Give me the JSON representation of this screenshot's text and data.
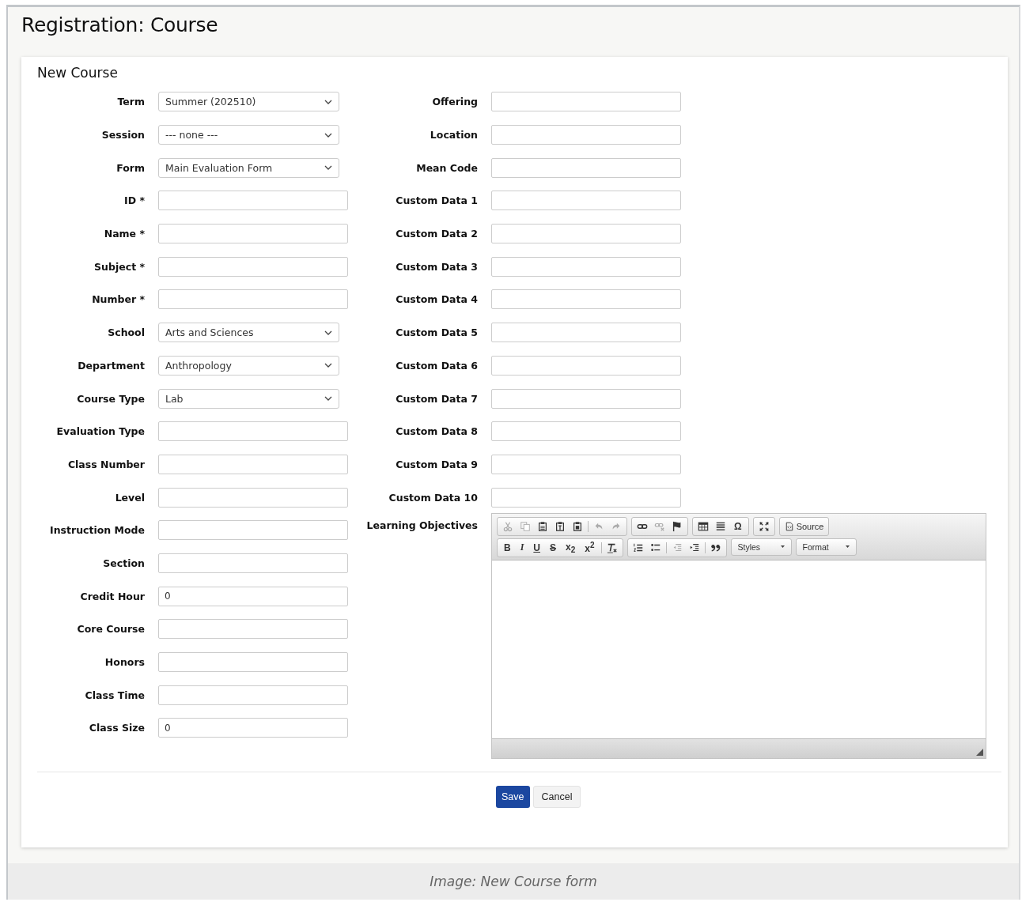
{
  "page": {
    "title": "Registration: Course"
  },
  "form": {
    "title": "New Course",
    "left_fields": [
      {
        "label": "Term",
        "kind": "select",
        "value": "Summer (202510)"
      },
      {
        "label": "Session",
        "kind": "select",
        "value": "--- none ---"
      },
      {
        "label": "Form",
        "kind": "select",
        "value": "Main Evaluation Form"
      },
      {
        "label": "ID *",
        "kind": "text"
      },
      {
        "label": "Name *",
        "kind": "text"
      },
      {
        "label": "Subject *",
        "kind": "text"
      },
      {
        "label": "Number *",
        "kind": "text"
      },
      {
        "label": "School",
        "kind": "select",
        "value": "Arts and Sciences"
      },
      {
        "label": "Department",
        "kind": "select",
        "value": "Anthropology"
      },
      {
        "label": "Course Type",
        "kind": "select",
        "value": "Lab"
      },
      {
        "label": "Evaluation Type",
        "kind": "text"
      },
      {
        "label": "Class Number",
        "kind": "text"
      },
      {
        "label": "Level",
        "kind": "text"
      },
      {
        "label": "Instruction Mode",
        "kind": "text"
      },
      {
        "label": "Section",
        "kind": "text"
      },
      {
        "label": "Credit Hour",
        "kind": "text",
        "value": "0"
      },
      {
        "label": "Core Course",
        "kind": "text"
      },
      {
        "label": "Honors",
        "kind": "text"
      },
      {
        "label": "Class Time",
        "kind": "text"
      },
      {
        "label": "Class Size",
        "kind": "text",
        "value": "0"
      }
    ],
    "right_fields": [
      {
        "label": "Offering",
        "kind": "text"
      },
      {
        "label": "Location",
        "kind": "text"
      },
      {
        "label": "Mean Code",
        "kind": "text"
      },
      {
        "label": "Custom Data 1",
        "kind": "text"
      },
      {
        "label": "Custom Data 2",
        "kind": "text"
      },
      {
        "label": "Custom Data 3",
        "kind": "text"
      },
      {
        "label": "Custom Data 4",
        "kind": "text"
      },
      {
        "label": "Custom Data 5",
        "kind": "text"
      },
      {
        "label": "Custom Data 6",
        "kind": "text"
      },
      {
        "label": "Custom Data 7",
        "kind": "text"
      },
      {
        "label": "Custom Data 8",
        "kind": "text"
      },
      {
        "label": "Custom Data 9",
        "kind": "text"
      },
      {
        "label": "Custom Data 10",
        "kind": "text"
      }
    ],
    "editor": {
      "label": "Learning Objectives",
      "toolbar_rows": [
        [
          [
            {
              "kind": "cut",
              "disabled": true
            },
            {
              "kind": "copy",
              "disabled": true
            },
            {
              "kind": "paste",
              "disabled": false
            },
            {
              "kind": "paste-text",
              "disabled": false
            },
            {
              "kind": "paste-word",
              "disabled": false
            },
            {
              "kind": "sep"
            },
            {
              "kind": "undo",
              "disabled": true
            },
            {
              "kind": "redo",
              "disabled": true
            }
          ],
          [
            {
              "kind": "link",
              "disabled": false
            },
            {
              "kind": "unlink",
              "disabled": true
            },
            {
              "kind": "anchor",
              "disabled": false
            }
          ],
          [
            {
              "kind": "table",
              "disabled": false
            },
            {
              "kind": "rule",
              "disabled": false
            },
            {
              "kind": "special-char",
              "text": "Ω",
              "disabled": false
            }
          ],
          [
            {
              "kind": "maximize",
              "disabled": false
            }
          ],
          [
            {
              "kind": "source",
              "text": "Source",
              "disabled": false
            }
          ]
        ],
        [
          [
            {
              "kind": "bold",
              "text": "B",
              "disabled": false
            },
            {
              "kind": "italic",
              "text": "I",
              "disabled": false
            },
            {
              "kind": "underline",
              "text": "U",
              "disabled": false
            },
            {
              "kind": "strike",
              "text": "S",
              "disabled": false
            },
            {
              "kind": "subscript",
              "text": "x$_{2}$",
              "disabled": false
            },
            {
              "kind": "superscript",
              "text": "x$^{2}$",
              "disabled": false
            },
            {
              "kind": "sep"
            },
            {
              "kind": "clear-format",
              "disabled": false
            }
          ],
          [
            {
              "kind": "numbered-list",
              "disabled": false
            },
            {
              "kind": "bullet-list",
              "disabled": false
            },
            {
              "kind": "sep"
            },
            {
              "kind": "outdent",
              "disabled": true
            },
            {
              "kind": "indent",
              "disabled": false
            },
            {
              "kind": "sep"
            },
            {
              "kind": "quote",
              "disabled": false
            }
          ],
          [
            {
              "kind": "combo",
              "text": "Styles"
            }
          ],
          [
            {
              "kind": "combo",
              "text": "Format"
            }
          ]
        ]
      ]
    },
    "buttons": [
      {
        "label": "Save",
        "kind": "primary"
      },
      {
        "label": "Cancel",
        "kind": "secondary"
      }
    ]
  },
  "caption": "Image: New Course form"
}
